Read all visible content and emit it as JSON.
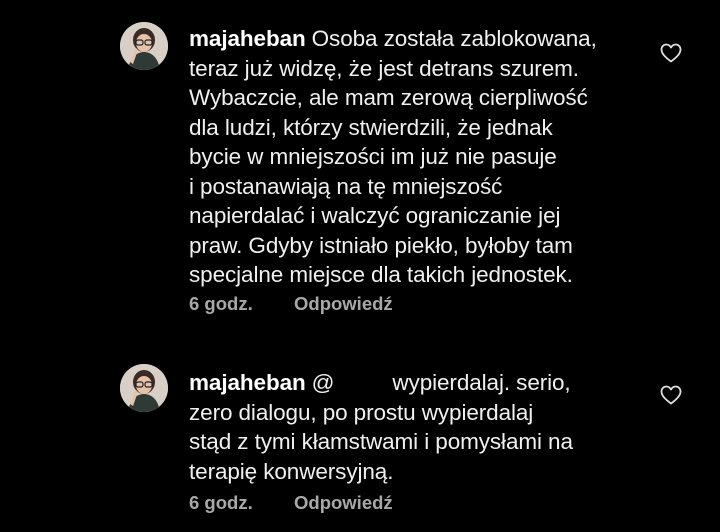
{
  "comments": [
    {
      "username": "majaheban",
      "lines": [
        "Osoba została zablokowana,",
        "teraz już widzę, że jest detrans szurem.",
        "Wybaczcie, ale mam zerową cierpliwość",
        "dla ludzi, którzy stwierdzili, że jednak",
        "bycie w mniejszości im już nie pasuje",
        "i postanawiają na tę mniejszość",
        "napierdalać i walczyć ograniczanie jej",
        "praw. Gdyby istniało piekło, byłoby tam",
        "specjalne miejsce dla takich jednostek."
      ],
      "time": "6 godz.",
      "reply_label": "Odpowiedź",
      "like_icon": "heart-outline-icon"
    },
    {
      "username": "majaheban",
      "mention_prefix": "@",
      "first_line_rest": "wypierdalaj. serio,",
      "lines": [
        "zero dialogu, po prostu wypierdalaj",
        "stąd z tymi kłamstwami i pomysłami na",
        "terapię konwersyjną."
      ],
      "time": "6 godz.",
      "reply_label": "Odpowiedź",
      "like_icon": "heart-outline-icon"
    }
  ],
  "colors": {
    "background": "#000000",
    "text": "#f0f0f0",
    "meta": "#a8a8a8",
    "heart": "#e0e0e0"
  }
}
